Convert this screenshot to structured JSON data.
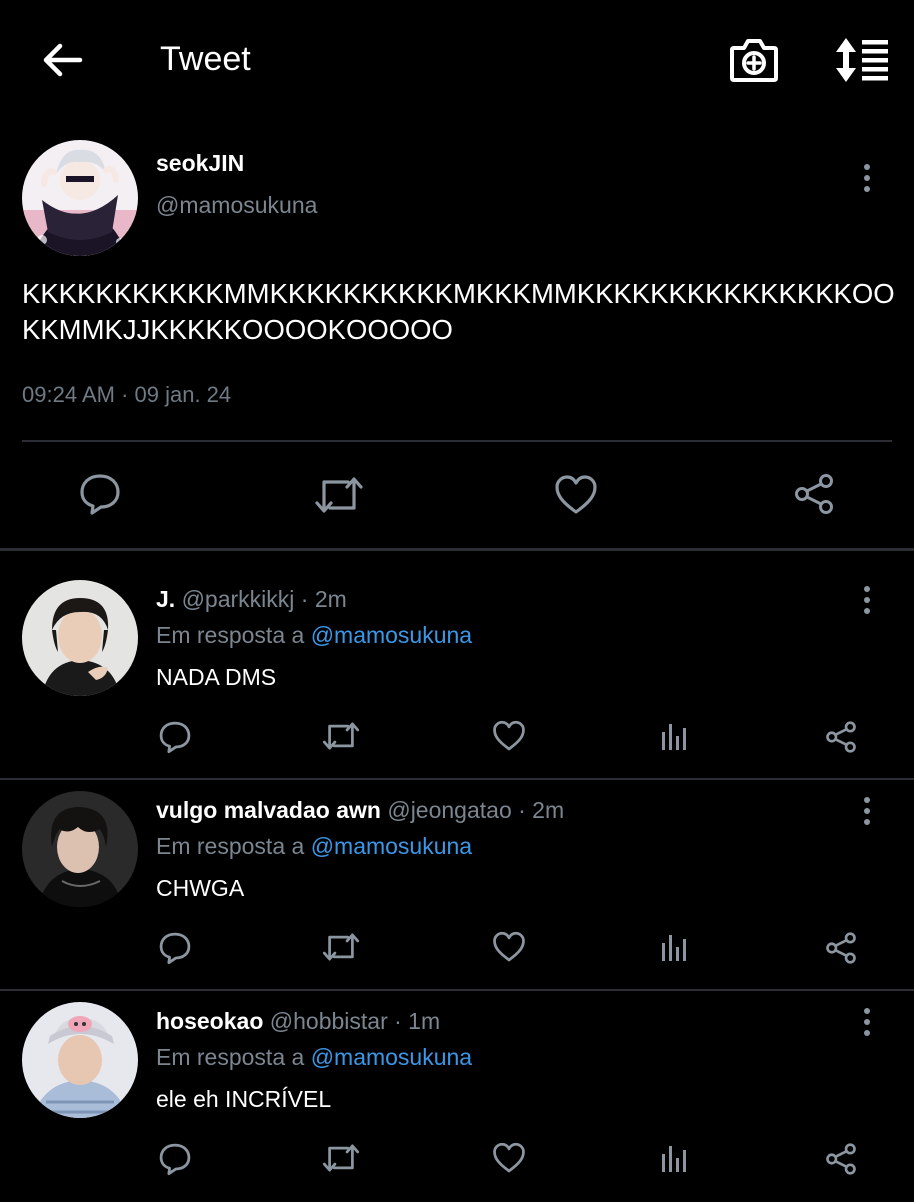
{
  "header": {
    "title": "Tweet",
    "back_icon": "back-arrow-icon",
    "camera_icon": "camera-plus-icon",
    "sort_icon": "sort-list-icon"
  },
  "main_tweet": {
    "name": "seokJIN",
    "handle": "@mamosukuna",
    "text": "KKKKKKKKKKKMMKKKKKKKKKKMKKKMMKKKKKKKKKKKKKKKOOKKMMKJJKKKKKOOOOKOOOOO",
    "timestamp": "09:24 AM · 09 jan. 24"
  },
  "replies": [
    {
      "name": "J.",
      "handle": "@parkkikkj",
      "time": "· 2m",
      "reply_prefix": "Em resposta a",
      "reply_to": "@mamosukuna",
      "text": "NADA DMS"
    },
    {
      "name": "vulgo malvadao awn",
      "handle": "@jeongatao",
      "time": "· 2m",
      "reply_prefix": "Em resposta a",
      "reply_to": "@mamosukuna",
      "text": "CHWGA"
    },
    {
      "name": "hoseokao",
      "handle": "@hobbistar",
      "time": "· 1m",
      "reply_prefix": "Em resposta a",
      "reply_to": "@mamosukuna",
      "text": "ele eh INCRÍVEL"
    }
  ],
  "colors": {
    "background": "#000000",
    "text": "#ffffff",
    "secondary": "#7b8690",
    "mention": "#3b98e8",
    "divider": "#2b2f33",
    "icon": "#8b96a0"
  }
}
